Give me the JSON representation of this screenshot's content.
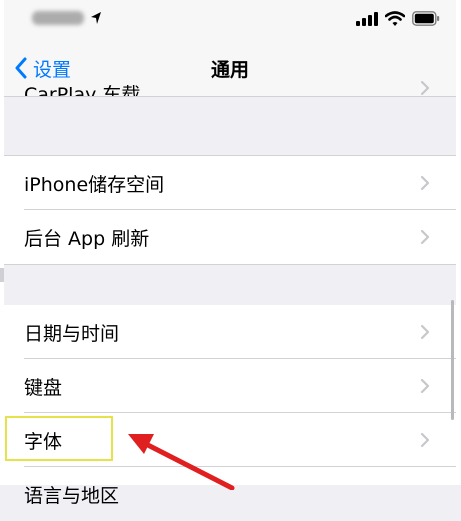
{
  "status_bar": {
    "icons": [
      "location-arrow-icon",
      "signal-bars-icon",
      "wifi-icon",
      "battery-icon"
    ]
  },
  "nav": {
    "back_label": "设置",
    "title": "通用",
    "partial_row_label": "CarPlay 车载"
  },
  "groups": [
    {
      "items": [
        {
          "label": "iPhone储存空间"
        },
        {
          "label": "后台 App 刷新"
        }
      ]
    },
    {
      "items": [
        {
          "label": "日期与时间"
        },
        {
          "label": "键盘"
        },
        {
          "label": "字体"
        },
        {
          "label": "语言与地区"
        }
      ]
    }
  ],
  "colors": {
    "accent": "#007aff",
    "background": "#efeff4",
    "highlight_box": "#e6e34a",
    "annotation_arrow": "#e02020"
  }
}
